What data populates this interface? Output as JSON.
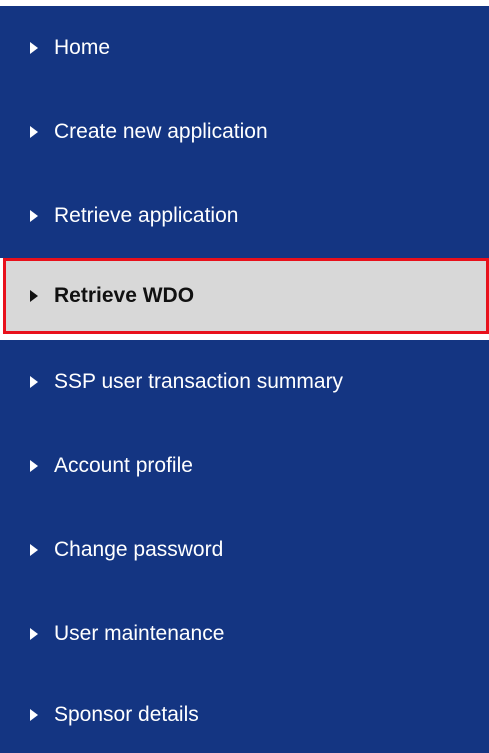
{
  "nav": {
    "items": [
      {
        "label": "Home"
      },
      {
        "label": "Create new application"
      },
      {
        "label": "Retrieve application"
      },
      {
        "label": "Retrieve WDO",
        "active": true
      },
      {
        "label": "SSP user transaction summary"
      },
      {
        "label": "Account profile"
      },
      {
        "label": "Change password"
      },
      {
        "label": "User maintenance"
      },
      {
        "label": "Sponsor details"
      }
    ]
  },
  "colors": {
    "nav_background": "#143582",
    "active_background": "#d8d8d8",
    "highlight_border": "#e8101b"
  }
}
